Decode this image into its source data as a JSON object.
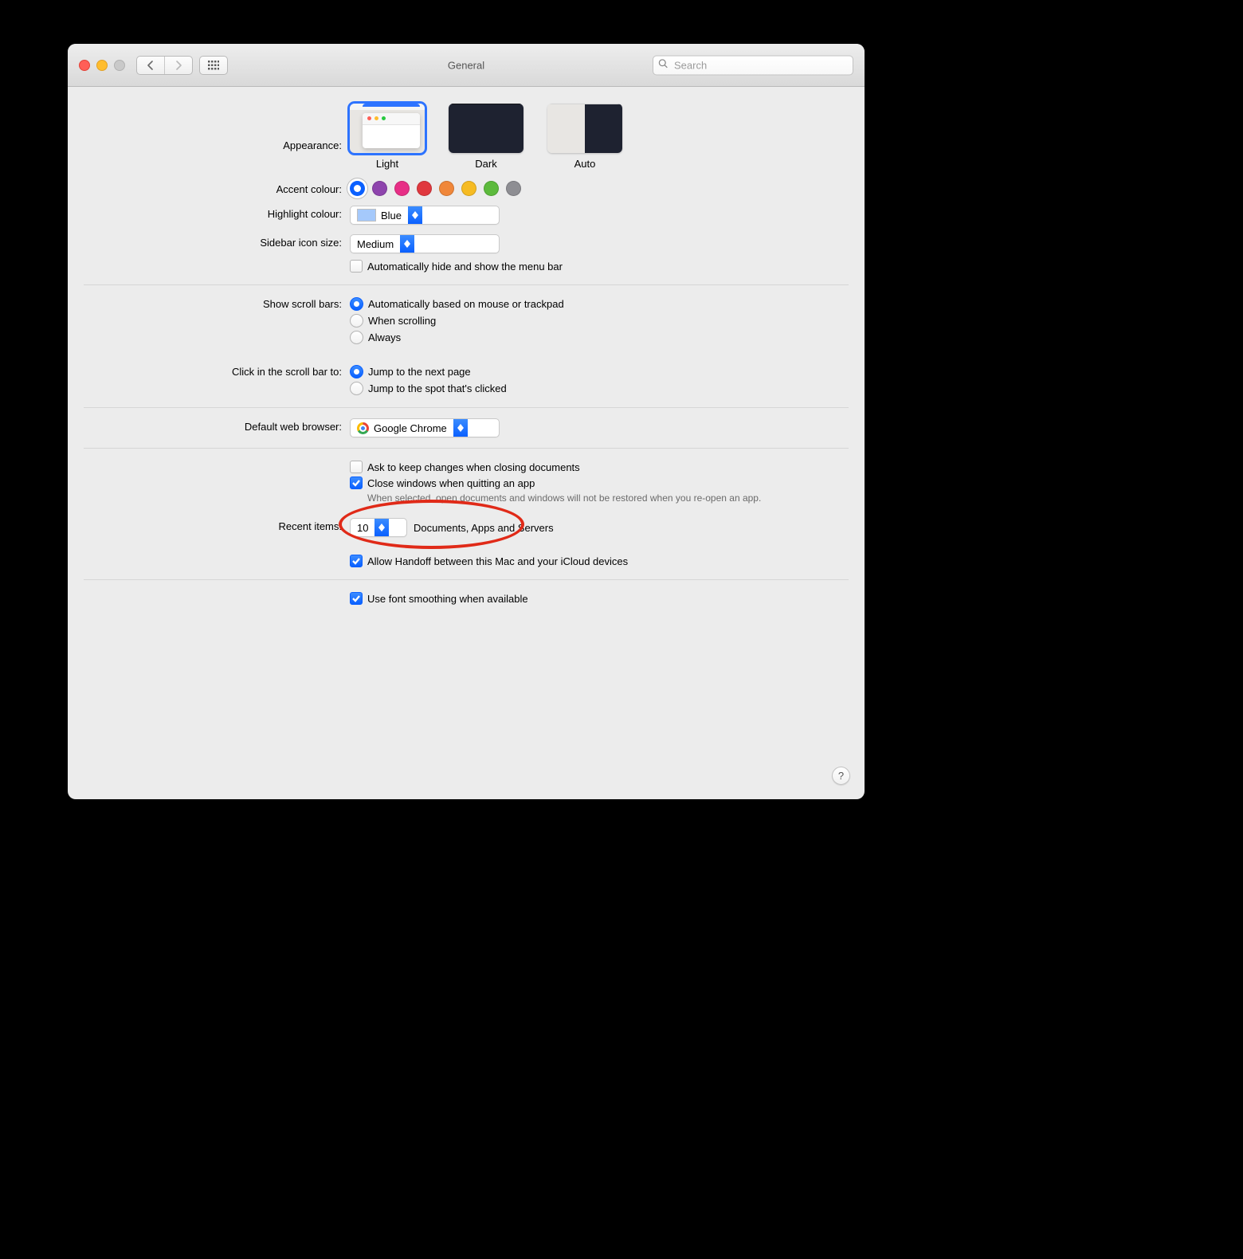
{
  "toolbar": {
    "title": "General",
    "search_placeholder": "Search"
  },
  "appearance": {
    "label": "Appearance:",
    "options": [
      "Light",
      "Dark",
      "Auto"
    ],
    "selected": "Light"
  },
  "accent": {
    "label": "Accent colour:",
    "colors": [
      "#0a60ff",
      "#8e44ad",
      "#e72e86",
      "#e0383e",
      "#f0873a",
      "#f6bb22",
      "#5cba3c",
      "#8e8e93"
    ]
  },
  "highlight": {
    "label": "Highlight colour:",
    "value": "Blue"
  },
  "sidebar_size": {
    "label": "Sidebar icon size:",
    "value": "Medium"
  },
  "auto_hide_menubar": "Automatically hide and show the menu bar",
  "scrollbars": {
    "label": "Show scroll bars:",
    "options": [
      "Automatically based on mouse or trackpad",
      "When scrolling",
      "Always"
    ]
  },
  "scroll_click": {
    "label": "Click in the scroll bar to:",
    "options": [
      "Jump to the next page",
      "Jump to the spot that's clicked"
    ]
  },
  "default_browser": {
    "label": "Default web browser:",
    "value": "Google Chrome"
  },
  "ask_keep": "Ask to keep changes when closing documents",
  "close_windows": "Close windows when quitting an app",
  "close_windows_hint": "When selected, open documents and windows will not be restored when you re-open an app.",
  "recent_items": {
    "label": "Recent items:",
    "value": "10",
    "suffix": "Documents, Apps and Servers"
  },
  "handoff": "Allow Handoff between this Mac and your iCloud devices",
  "font_smoothing": "Use font smoothing when available",
  "help": "?"
}
